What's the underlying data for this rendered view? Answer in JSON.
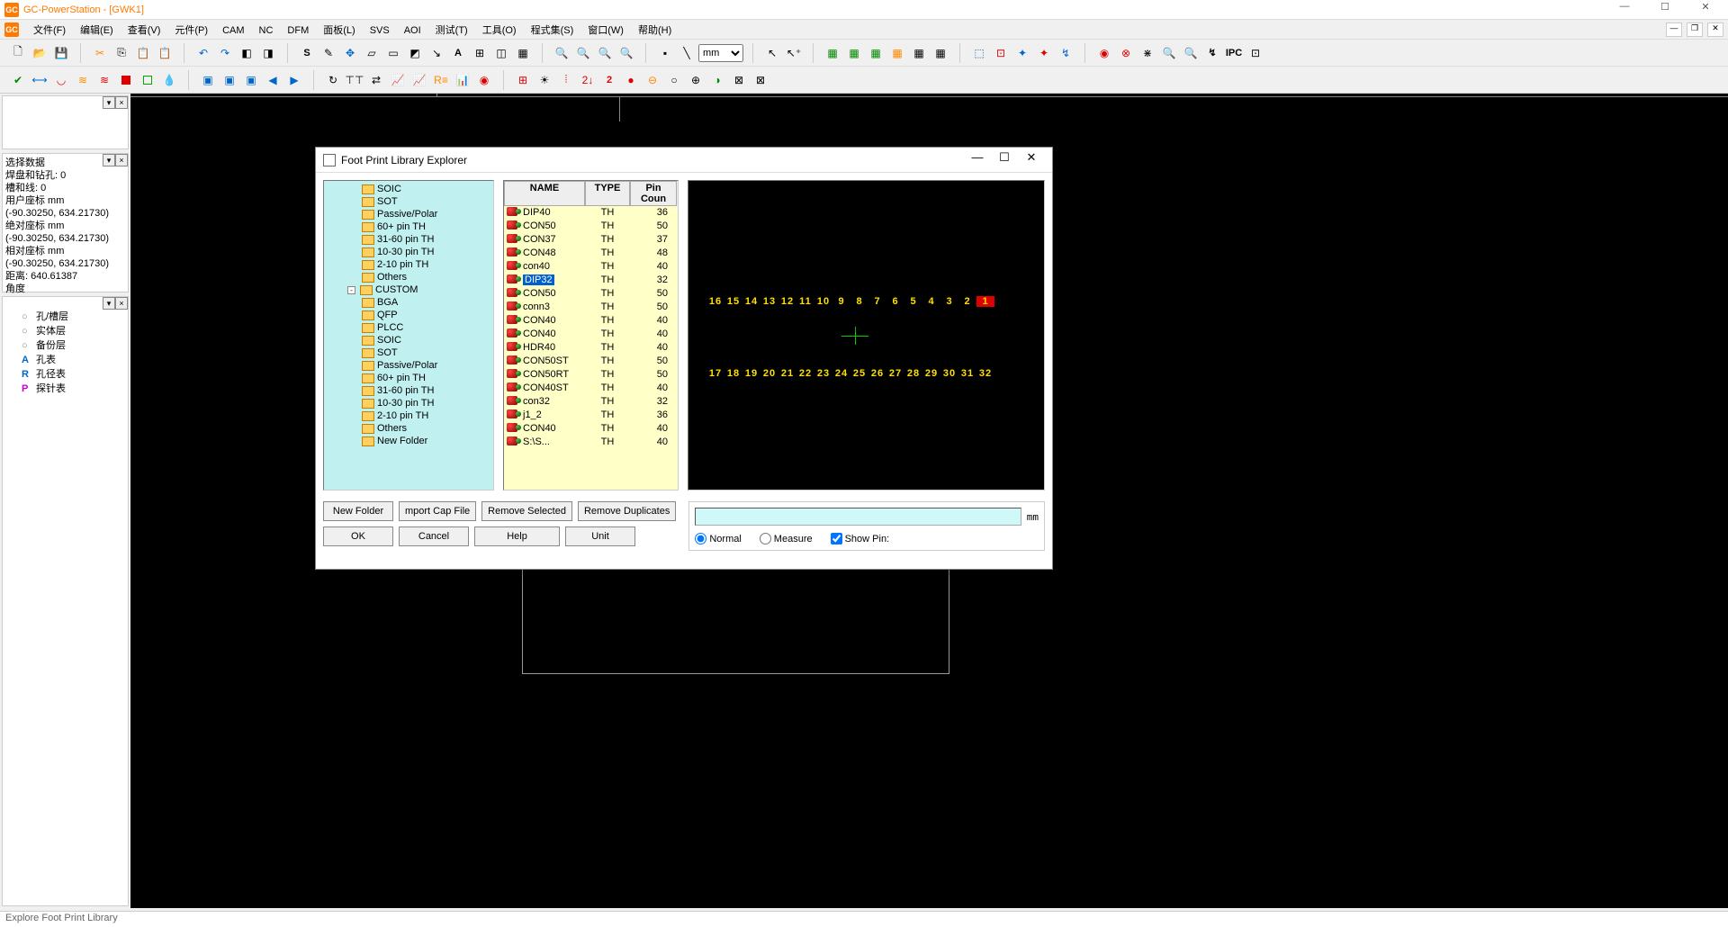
{
  "window": {
    "title": "GC-PowerStation - [GWK1]",
    "app_abbrev": "GC"
  },
  "menus": [
    "文件(F)",
    "编辑(E)",
    "查看(V)",
    "元件(P)",
    "CAM",
    "NC",
    "DFM",
    "面板(L)",
    "SVS",
    "AOI",
    "测试(T)",
    "工具(O)",
    "程式集(S)",
    "窗口(W)",
    "帮助(H)"
  ],
  "unit_selector": "mm",
  "info_panel": {
    "lines": [
      "选择数据",
      "焊盘和钻孔: 0",
      "槽和线: 0",
      "用户座标 mm",
      "(-90.30250, 634.21730)",
      "绝对座标 mm",
      "(-90.30250, 634.21730)",
      "相对座标 mm",
      "(-90.30250, 634.21730)",
      "距离: 640.61387",
      "角度"
    ]
  },
  "layer_tree": [
    "孔/槽层",
    "实体层",
    "备份层",
    "孔表",
    "孔径表",
    "探针表"
  ],
  "statusbar": "Explore Foot Print Library",
  "dialog": {
    "title": "Foot Print Library Explorer",
    "folders_lvl1": [
      "SOIC",
      "SOT",
      "Passive/Polar",
      "60+ pin TH",
      "31-60 pin TH",
      "10-30 pin TH",
      "2-10 pin TH",
      "Others"
    ],
    "custom_label": "CUSTOM",
    "folders_lvl2": [
      "BGA",
      "QFP",
      "PLCC",
      "SOIC",
      "SOT",
      "Passive/Polar",
      "60+ pin TH",
      "31-60 pin TH",
      "10-30 pin TH",
      "2-10 pin TH",
      "Others",
      "New Folder"
    ],
    "list_headers": {
      "name": "NAME",
      "type": "TYPE",
      "pin": "Pin Coun"
    },
    "list_rows": [
      {
        "name": "DIP40",
        "type": "TH",
        "pin": 36
      },
      {
        "name": "CON50",
        "type": "TH",
        "pin": 50
      },
      {
        "name": "CON37",
        "type": "TH",
        "pin": 37
      },
      {
        "name": "CON48",
        "type": "TH",
        "pin": 48
      },
      {
        "name": "con40",
        "type": "TH",
        "pin": 40
      },
      {
        "name": "DIP32",
        "type": "TH",
        "pin": 32,
        "selected": true
      },
      {
        "name": "CON50",
        "type": "TH",
        "pin": 50
      },
      {
        "name": "conn3",
        "type": "TH",
        "pin": 50
      },
      {
        "name": "CON40",
        "type": "TH",
        "pin": 40
      },
      {
        "name": "CON40",
        "type": "TH",
        "pin": 40
      },
      {
        "name": "HDR40",
        "type": "TH",
        "pin": 40
      },
      {
        "name": "CON50ST",
        "type": "TH",
        "pin": 50
      },
      {
        "name": "CON50RT",
        "type": "TH",
        "pin": 50
      },
      {
        "name": "CON40ST",
        "type": "TH",
        "pin": 40
      },
      {
        "name": "con32",
        "type": "TH",
        "pin": 32
      },
      {
        "name": "j1_2",
        "type": "TH",
        "pin": 36
      },
      {
        "name": "CON40",
        "type": "TH",
        "pin": 40
      },
      {
        "name": "S:\\S...",
        "type": "TH",
        "pin": 40
      }
    ],
    "preview_top": [
      "16",
      "15",
      "14",
      "13",
      "12",
      "11",
      "10",
      "9",
      "8",
      "7",
      "6",
      "5",
      "4",
      "3",
      "2",
      "1"
    ],
    "preview_bottom": [
      "17",
      "18",
      "19",
      "20",
      "21",
      "22",
      "23",
      "24",
      "25",
      "26",
      "27",
      "28",
      "29",
      "30",
      "31",
      "32"
    ],
    "buttons": {
      "new_folder": "New Folder",
      "import": "mport Cap File",
      "remove_sel": "Remove Selected",
      "remove_dup": "Remove Duplicates",
      "ok": "OK",
      "cancel": "Cancel",
      "help": "Help",
      "unit": "Unit"
    },
    "coord_unit": "mm",
    "radios": {
      "normal": "Normal",
      "measure": "Measure",
      "showpin": "Show Pin:"
    }
  }
}
